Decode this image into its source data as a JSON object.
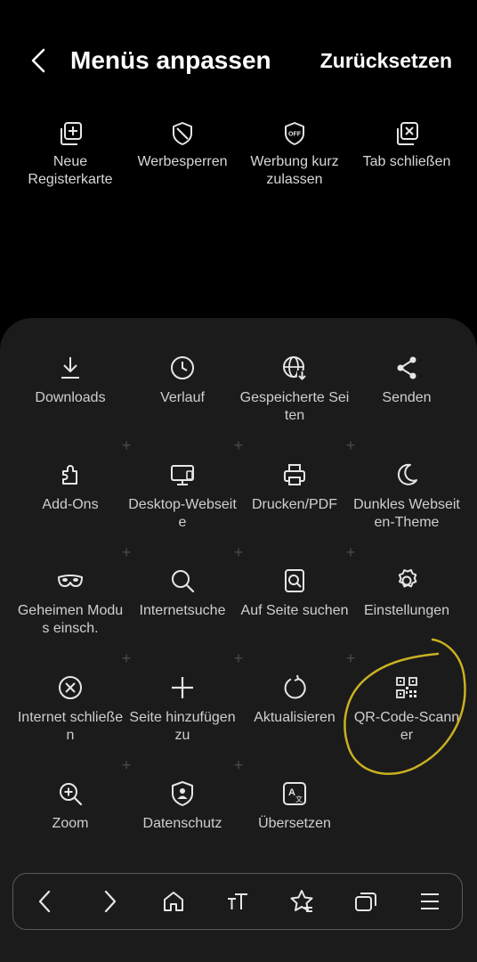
{
  "header": {
    "title": "Menüs anpassen",
    "reset_label": "Zurücksetzen"
  },
  "pinned_items": [
    {
      "label": "Neue Registerkarte",
      "icon": "new-tab-icon"
    },
    {
      "label": "Werbesperren",
      "icon": "shield-icon"
    },
    {
      "label": "Werbung kurz zulassen",
      "icon": "ad-off-icon"
    },
    {
      "label": "Tab schließen",
      "icon": "close-tab-icon"
    }
  ],
  "menu_grid": [
    [
      {
        "label": "Downloads",
        "icon": "download-icon"
      },
      {
        "label": "Verlauf",
        "icon": "history-icon"
      },
      {
        "label": "Gespeicherte Seiten",
        "icon": "saved-pages-icon"
      },
      {
        "label": "Senden",
        "icon": "share-icon"
      }
    ],
    [
      {
        "label": "Add-Ons",
        "icon": "puzzle-icon"
      },
      {
        "label": "Desktop-Webseite",
        "icon": "desktop-icon"
      },
      {
        "label": "Drucken/PDF",
        "icon": "print-icon"
      },
      {
        "label": "Dunkles Webseiten-Theme",
        "icon": "moon-icon"
      }
    ],
    [
      {
        "label": "Geheimen Modus einsch.",
        "icon": "mask-icon"
      },
      {
        "label": "Internetsuche",
        "icon": "search-icon"
      },
      {
        "label": "Auf Seite suchen",
        "icon": "find-in-page-icon"
      },
      {
        "label": "Einstellungen",
        "icon": "gear-icon"
      }
    ],
    [
      {
        "label": "Internet schließen",
        "icon": "close-circle-icon"
      },
      {
        "label": "Seite hinzufügen zu",
        "icon": "plus-icon"
      },
      {
        "label": "Aktualisieren",
        "icon": "refresh-icon"
      },
      {
        "label": "QR-Code-Scanner",
        "icon": "qr-code-icon"
      }
    ],
    [
      {
        "label": "Zoom",
        "icon": "zoom-icon"
      },
      {
        "label": "Datenschutz",
        "icon": "privacy-shield-icon"
      },
      {
        "label": "Übersetzen",
        "icon": "translate-icon"
      }
    ]
  ],
  "toolbar": [
    {
      "icon": "back-icon"
    },
    {
      "icon": "forward-icon"
    },
    {
      "icon": "home-icon"
    },
    {
      "icon": "text-size-icon"
    },
    {
      "icon": "bookmark-star-icon"
    },
    {
      "icon": "tabs-icon"
    },
    {
      "icon": "menu-icon"
    }
  ],
  "colors": {
    "background": "#000000",
    "panel": "#1b1b1b",
    "annotation": "#c9b021"
  }
}
